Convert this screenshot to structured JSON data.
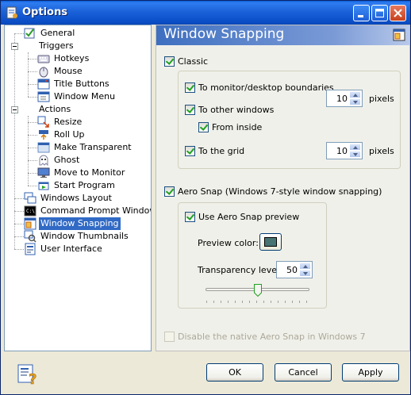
{
  "window": {
    "title": "Options"
  },
  "tree": {
    "items": [
      {
        "label": "General",
        "icon": "general-icon"
      },
      {
        "label": "Triggers",
        "icon": "none"
      },
      {
        "label": "Hotkeys",
        "icon": "keyboard-icon"
      },
      {
        "label": "Mouse",
        "icon": "mouse-icon"
      },
      {
        "label": "Title Buttons",
        "icon": "title-buttons-icon"
      },
      {
        "label": "Window Menu",
        "icon": "window-menu-icon"
      },
      {
        "label": "Actions",
        "icon": "none"
      },
      {
        "label": "Resize",
        "icon": "resize-icon"
      },
      {
        "label": "Roll Up",
        "icon": "roll-up-icon"
      },
      {
        "label": "Make Transparent",
        "icon": "transparent-icon"
      },
      {
        "label": "Ghost",
        "icon": "ghost-icon"
      },
      {
        "label": "Move to Monitor",
        "icon": "monitor-icon"
      },
      {
        "label": "Start Program",
        "icon": "start-program-icon"
      },
      {
        "label": "Windows Layout",
        "icon": "windows-layout-icon"
      },
      {
        "label": "Command Prompt Windows",
        "icon": "command-prompt-icon"
      },
      {
        "label": "Window Snapping",
        "icon": "window-snapping-icon"
      },
      {
        "label": "Window Thumbnails",
        "icon": "window-thumbnails-icon"
      },
      {
        "label": "User Interface",
        "icon": "user-interface-icon"
      }
    ],
    "selected": "Window Snapping"
  },
  "panel": {
    "title": "Window Snapping",
    "classic": {
      "label": "Classic",
      "checked": true,
      "to_monitor_label": "To monitor/desktop boundaries",
      "to_other_windows_label": "To other windows",
      "from_inside_label": "From inside",
      "to_grid_label": "To the grid",
      "monitor_pixels": "10",
      "grid_pixels": "10",
      "pixels_unit": "pixels"
    },
    "aero": {
      "label": "Aero Snap (Windows 7-style window snapping)",
      "use_preview_label": "Use Aero Snap preview",
      "preview_color_label": "Preview color:",
      "preview_color": "#477373",
      "transparency_label": "Transparency level",
      "transparency_value": "50"
    },
    "disable_native_label": "Disable the native Aero Snap in Windows 7"
  },
  "buttons": {
    "ok": "OK",
    "cancel": "Cancel",
    "apply": "Apply"
  }
}
